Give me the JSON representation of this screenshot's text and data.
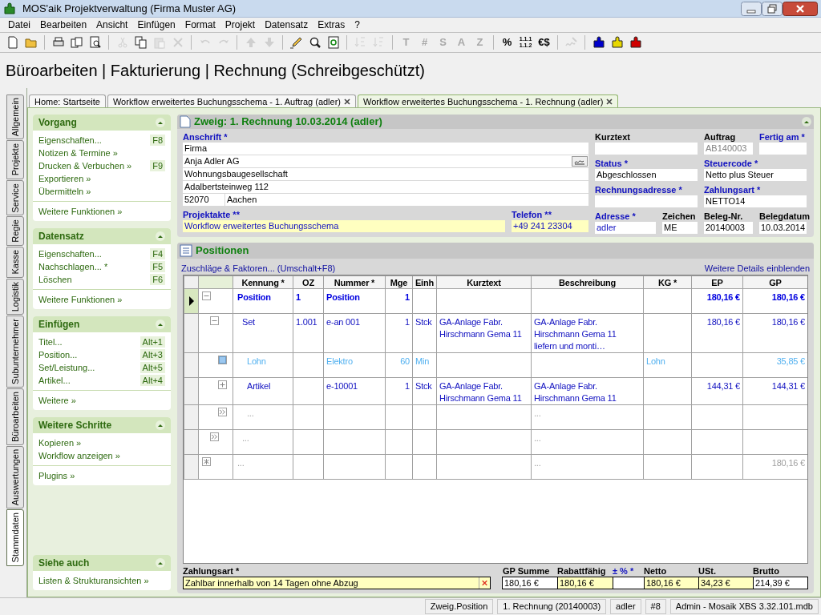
{
  "window": {
    "title": "MOS'aik Projektverwaltung (Firma Muster AG)"
  },
  "menu": [
    "Datei",
    "Bearbeiten",
    "Ansicht",
    "Einfügen",
    "Format",
    "Projekt",
    "Datensatz",
    "Extras",
    "?"
  ],
  "toolbar": [
    [
      {
        "kind": "new",
        "disabled": false
      },
      {
        "kind": "open",
        "disabled": false
      }
    ],
    [
      {
        "kind": "print",
        "disabled": false
      },
      {
        "kind": "pages",
        "disabled": false
      },
      {
        "kind": "preview",
        "disabled": false
      }
    ],
    [
      {
        "kind": "cut",
        "disabled": true
      },
      {
        "kind": "copy",
        "disabled": false
      },
      {
        "kind": "paste",
        "disabled": true
      },
      {
        "kind": "delete",
        "disabled": true
      }
    ],
    [
      {
        "kind": "undo",
        "disabled": true
      },
      {
        "kind": "redo",
        "disabled": true
      }
    ],
    [
      {
        "kind": "up",
        "disabled": true
      },
      {
        "kind": "down",
        "disabled": true
      }
    ],
    [
      {
        "kind": "pencil",
        "disabled": false
      },
      {
        "kind": "find",
        "disabled": false
      },
      {
        "kind": "refresh",
        "disabled": false
      }
    ],
    [
      {
        "kind": "sortasc",
        "disabled": true
      },
      {
        "kind": "sortdesc",
        "disabled": true
      }
    ],
    [
      {
        "kind": "text",
        "label": "T",
        "disabled": true
      },
      {
        "kind": "text",
        "label": "#",
        "disabled": true
      },
      {
        "kind": "text",
        "label": "S",
        "disabled": true
      },
      {
        "kind": "text",
        "label": "A",
        "disabled": true
      },
      {
        "kind": "text",
        "label": "Z",
        "disabled": true
      }
    ],
    [
      {
        "kind": "text",
        "label": "%",
        "disabled": false
      },
      {
        "kind": "stack",
        "lines": [
          "1.1.1",
          "1.1.2"
        ],
        "disabled": false
      },
      {
        "kind": "text",
        "label": "€$",
        "disabled": false
      }
    ],
    [
      {
        "kind": "sign",
        "disabled": true
      }
    ],
    [
      {
        "kind": "puzzle",
        "color": "#0000cc",
        "disabled": false
      },
      {
        "kind": "puzzle",
        "color": "#e8d800",
        "disabled": false
      },
      {
        "kind": "puzzle",
        "color": "#d00000",
        "disabled": false
      }
    ]
  ],
  "heading": "Büroarbeiten | Fakturierung | Rechnung (Schreibgeschützt)",
  "side_tabs": [
    {
      "label": "Allgemein",
      "selected": false
    },
    {
      "label": "Projekte",
      "selected": false
    },
    {
      "label": "Service",
      "selected": false
    },
    {
      "label": "Regie",
      "selected": false
    },
    {
      "label": "Kasse",
      "selected": false
    },
    {
      "label": "Logistik",
      "selected": false
    },
    {
      "label": "Subunternehmer",
      "selected": false
    },
    {
      "label": "Büroarbeiten",
      "selected": false
    },
    {
      "label": "Auswertungen",
      "selected": false
    },
    {
      "label": "Stammdaten",
      "selected": true
    }
  ],
  "doc_tabs": [
    {
      "label": "Home: Startseite",
      "closable": false,
      "selected": false
    },
    {
      "label": "Workflow erweitertes Buchungsschema - 1. Auftrag (adler)",
      "closable": true,
      "selected": false
    },
    {
      "label": "Workflow erweitertes Buchungsschema - 1. Rechnung (adler)",
      "closable": true,
      "selected": true
    }
  ],
  "task_panel": [
    {
      "title": "Vorgang",
      "expanded": true,
      "items": [
        {
          "label": "Eigenschaften...",
          "shortcut": "F8"
        },
        {
          "label": "Notizen & Termine »"
        },
        {
          "label": "Drucken & Verbuchen »",
          "shortcut": "F9"
        },
        {
          "label": "Exportieren »"
        },
        {
          "label": "Übermitteln »"
        }
      ],
      "footer": [
        "Weitere Funktionen »"
      ]
    },
    {
      "title": "Datensatz",
      "expanded": true,
      "items": [
        {
          "label": "Eigenschaften...",
          "shortcut": "F4"
        },
        {
          "label": "Nachschlagen... *",
          "shortcut": "F5"
        },
        {
          "label": "Löschen",
          "shortcut": "F6"
        }
      ],
      "footer": [
        "Weitere Funktionen »"
      ]
    },
    {
      "title": "Einfügen",
      "expanded": true,
      "items": [
        {
          "label": "Titel...",
          "shortcut": "Alt+1"
        },
        {
          "label": "Position...",
          "shortcut": "Alt+3"
        },
        {
          "label": "Set/Leistung...",
          "shortcut": "Alt+5"
        },
        {
          "label": "Artikel...",
          "shortcut": "Alt+4"
        }
      ],
      "footer": [
        "Weitere »"
      ]
    },
    {
      "title": "Weitere Schritte",
      "expanded": true,
      "items": [
        {
          "label": "Kopieren »"
        },
        {
          "label": "Workflow anzeigen »"
        }
      ],
      "footer": [
        "Plugins »"
      ]
    },
    {
      "title": "Siehe auch",
      "expanded": true,
      "items": [
        {
          "label": "Listen & Strukturansichten »"
        }
      ]
    }
  ],
  "zweig": {
    "title": "Zweig: 1. Rechnung 10.03.2014 (adler)",
    "expanded": true,
    "anschrift": {
      "label": "Anschrift *",
      "required": true,
      "lines": [
        "Firma",
        "Anja Adler AG",
        "Wohnungsbaugesellschaft",
        "Adalbertsteinweg 112"
      ],
      "plz": "52070",
      "ort": "Aachen"
    },
    "projektakte": {
      "label": "Projektakte **",
      "required": true,
      "value": "Workflow erweitertes Buchungsschema",
      "highlighted": true,
      "link": true
    },
    "telefon": {
      "label": "Telefon **",
      "required": true,
      "value": "+49 241 23304",
      "highlighted": true,
      "link": true
    },
    "right_rows": [
      [
        {
          "label": "Kurztext",
          "required": false
        },
        {
          "label": "Auftrag",
          "required": false,
          "value": "AB140003",
          "readonly": true
        },
        {
          "label": "Fertig am *",
          "required": true
        }
      ],
      [
        {
          "label": "Status *",
          "required": true,
          "value": "Abgeschlossen"
        },
        {
          "label": "Steuercode *",
          "required": true,
          "value": "Netto plus Steuer"
        }
      ],
      [
        {
          "label": "Rechnungsadresse *",
          "required": true
        },
        {
          "label": "Zahlungsart *",
          "required": true,
          "value": "NETTO14"
        }
      ],
      [
        {
          "label": "Adresse *",
          "required": true,
          "value": "adler",
          "link": true
        },
        {
          "label": "Zeichen",
          "required": false,
          "value": "ME"
        },
        {
          "label": "Beleg-Nr.",
          "required": false,
          "value": "20140003"
        },
        {
          "label": "Belegdatum",
          "required": false,
          "value": "10.03.2014"
        }
      ]
    ]
  },
  "positionen": {
    "title": "Positionen",
    "link_left": "Zuschläge & Faktoren... (Umschalt+F8)",
    "link_right": "Weitere Details einblenden",
    "columns": [
      "Kennung *",
      "OZ",
      "Nummer *",
      "Mge",
      "Einh",
      "Kurztext",
      "Beschreibung",
      "KG *",
      "EP",
      "GP"
    ],
    "rows": [
      {
        "kind": "position",
        "selected": true,
        "expanded": true,
        "kennung": "Position",
        "oz": "1",
        "nummer": "Position",
        "mge": "1",
        "ep": "180,16 €",
        "gp": "180,16 €",
        "children": [
          {
            "kind": "set",
            "selected": false,
            "expanded": true,
            "kennung": "Set",
            "oz": "1.001",
            "nummer": "e-an 001",
            "mge": "1",
            "einh": "Stck",
            "kurztext": "GA-Anlage Fabr. Hirschmann Gema 11",
            "beschreibung": "GA-Anlage Fabr. Hirschmann Gema 11 liefern und monti…",
            "ep": "180,16 €",
            "gp": "180,16 €",
            "children": [
              {
                "kind": "lohn",
                "selected": false,
                "kennung": "Lohn",
                "nummer": "Elektro",
                "mge": "60",
                "einh": "Min",
                "kg": "Lohn",
                "gp": "35,85 €"
              },
              {
                "kind": "artikel",
                "selected": false,
                "expanded": false,
                "kennung": "Artikel",
                "nummer": "e-10001",
                "mge": "1",
                "einh": "Stck",
                "kurztext": "GA-Anlage Fabr. Hirschmann Gema 11",
                "beschreibung": "GA-Anlage Fabr. Hirschmann Gema 11",
                "ep": "144,31 €",
                "gp": "144,31 €"
              },
              {
                "kind": "more",
                "selected": false,
                "kennung": "...",
                "beschreibung": "..."
              }
            ]
          },
          {
            "kind": "more",
            "selected": false,
            "kennung": "...",
            "beschreibung": "..."
          }
        ]
      },
      {
        "kind": "new",
        "selected": false,
        "kennung": "...",
        "beschreibung": "...",
        "gp": "180,16 €"
      }
    ]
  },
  "summary": {
    "zahlungsart": {
      "label": "Zahlungsart *",
      "value": "Zahlbar innerhalb von 14 Tagen ohne Abzug",
      "highlighted": true
    },
    "totals": [
      {
        "label": "GP Summe",
        "required": false,
        "value": "180,16 €",
        "highlighted": false
      },
      {
        "label": "Rabattfähig",
        "required": false,
        "value": "180,16 €",
        "highlighted": true
      },
      {
        "label": "± % *",
        "required": true,
        "highlighted": false
      },
      {
        "label": "Netto",
        "required": false,
        "value": "180,16 €",
        "highlighted": true
      },
      {
        "label": "USt.",
        "required": false,
        "value": "34,23 €",
        "highlighted": true
      },
      {
        "label": "Brutto",
        "required": false,
        "value": "214,39 €",
        "highlighted": false
      }
    ]
  },
  "status_bar": [
    "Zweig.Position",
    "1. Rechnung (20140003)",
    "adler",
    "#8",
    "Admin - Mosaik XBS 3.32.101.mdb"
  ]
}
